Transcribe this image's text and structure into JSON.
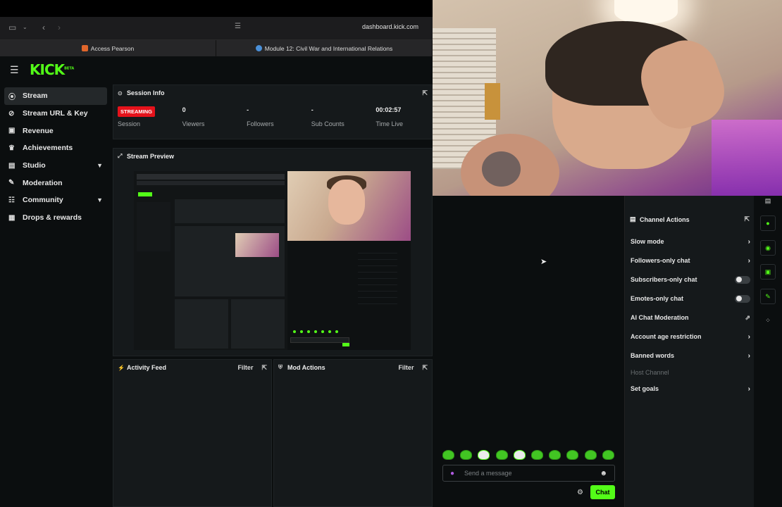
{
  "browser": {
    "url": "dashboard.kick.com",
    "tabs": [
      {
        "label": "Access Pearson",
        "fav_color": "#e1662b"
      },
      {
        "label": "Module 12: Civil War and International Relations",
        "fav_color": "#4a90d9"
      }
    ]
  },
  "app": {
    "logo": "KICK",
    "logo_tag": "BETA",
    "accent": "#53fc18"
  },
  "sidebar": {
    "items": [
      {
        "label": "Stream",
        "icon": "broadcast-icon",
        "active": true
      },
      {
        "label": "Stream URL & Key",
        "icon": "key-icon"
      },
      {
        "label": "Revenue",
        "icon": "revenue-icon"
      },
      {
        "label": "Achievements",
        "icon": "trophy-icon"
      },
      {
        "label": "Studio",
        "icon": "studio-icon",
        "expandable": true
      },
      {
        "label": "Moderation",
        "icon": "wrench-icon"
      },
      {
        "label": "Community",
        "icon": "community-icon",
        "expandable": true
      },
      {
        "label": "Drops & rewards",
        "icon": "drops-icon"
      }
    ]
  },
  "session": {
    "title": "Session Info",
    "status_badge": "STREAMING",
    "status_color": "#e5121b",
    "stats": [
      {
        "label": "Session",
        "value": ""
      },
      {
        "label": "Viewers",
        "value": "0"
      },
      {
        "label": "Followers",
        "value": "-"
      },
      {
        "label": "Sub Counts",
        "value": "-"
      },
      {
        "label": "Time Live",
        "value": "00:02:57"
      }
    ]
  },
  "preview": {
    "title": "Stream Preview"
  },
  "activity": {
    "title": "Activity Feed",
    "filter": "Filter"
  },
  "mod_actions": {
    "title": "Mod Actions",
    "filter": "Filter"
  },
  "chat": {
    "placeholder": "Send a message",
    "send_label": "Chat"
  },
  "channel_actions": {
    "title": "Channel Actions",
    "items": [
      {
        "label": "Slow mode",
        "control": "chevron"
      },
      {
        "label": "Followers-only chat",
        "control": "chevron"
      },
      {
        "label": "Subscribers-only chat",
        "control": "toggle",
        "enabled": false
      },
      {
        "label": "Emotes-only chat",
        "control": "toggle",
        "enabled": false
      },
      {
        "label": "AI Chat Moderation",
        "control": "trend"
      },
      {
        "label": "Account age restriction",
        "control": "chevron"
      },
      {
        "label": "Banned words",
        "control": "chevron"
      },
      {
        "label": "Host Channel",
        "control": "none",
        "disabled": true
      },
      {
        "label": "Set goals",
        "control": "chevron"
      }
    ]
  }
}
